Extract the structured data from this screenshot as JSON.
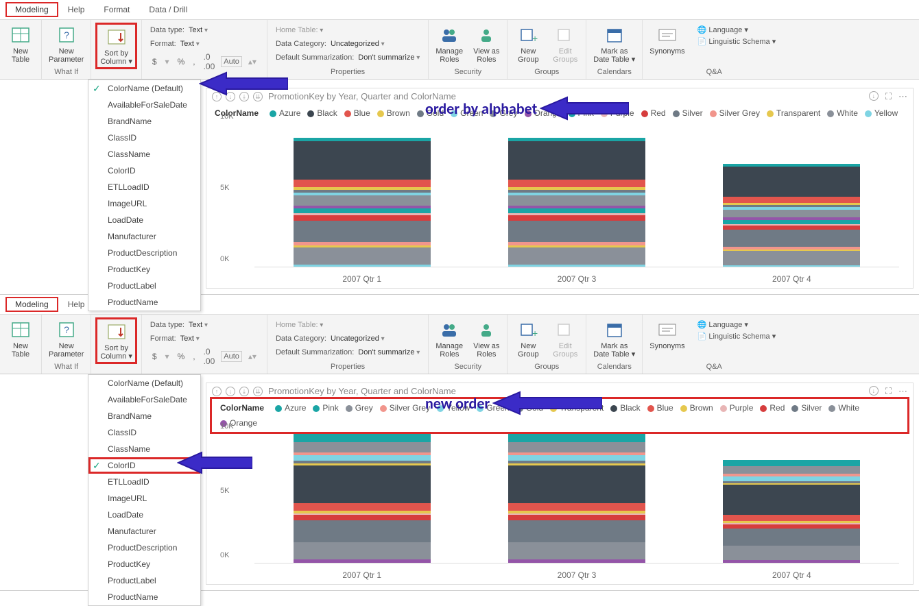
{
  "tabs": {
    "modeling": "Modeling",
    "help": "Help",
    "format": "Format",
    "datadrill": "Data / Drill"
  },
  "ribbon": {
    "new_table": "New\nTable",
    "new_parameter": "New\nParameter",
    "what_if": "What If",
    "sort_by_column": "Sort by\nColumn ▾",
    "formatting": {
      "datatype_label": "Data type:",
      "datatype_value": "Text",
      "format_label": "Format:",
      "format_value": "Text",
      "currency": "$",
      "percent": "%",
      "comma": ",",
      "decimal": ".0",
      "auto": "Auto"
    },
    "properties": {
      "home_table": "Home Table:",
      "data_category_label": "Data Category:",
      "data_category_value": "Uncategorized",
      "summ_label": "Default Summarization:",
      "summ_value": "Don't summarize",
      "group": "Properties"
    },
    "security": {
      "manage_roles": "Manage\nRoles",
      "view_as_roles": "View as\nRoles",
      "group": "Security"
    },
    "groups": {
      "new_group": "New\nGroup",
      "edit_groups": "Edit\nGroups",
      "group": "Groups"
    },
    "calendars": {
      "mark_as_date": "Mark as\nDate Table ▾",
      "group": "Calendars"
    },
    "qa": {
      "synonyms": "Synonyms",
      "language": "Language ▾",
      "linguistic": "Linguistic Schema ▾",
      "group": "Q&A"
    }
  },
  "dropdown_a": [
    "ColorName (Default)",
    "AvailableForSaleDate",
    "BrandName",
    "ClassID",
    "ClassName",
    "ColorID",
    "ETLLoadID",
    "ImageURL",
    "LoadDate",
    "Manufacturer",
    "ProductDescription",
    "ProductKey",
    "ProductLabel",
    "ProductName"
  ],
  "dropdown_b": [
    "ColorName (Default)",
    "AvailableForSaleDate",
    "BrandName",
    "ClassID",
    "ClassName",
    "ColorID",
    "ETLLoadID",
    "ImageURL",
    "LoadDate",
    "Manufacturer",
    "ProductDescription",
    "ProductKey",
    "ProductLabel",
    "ProductName"
  ],
  "annot": {
    "top": "order by alphabet",
    "bottom": "new order"
  },
  "chart": {
    "title": "PromotionKey by Year, Quarter and ColorName",
    "legend_label": "ColorName",
    "xcats": [
      "2007 Qtr 1",
      "2007 Qtr 3",
      "2007 Qtr 4"
    ],
    "yticks": [
      "0K",
      "5K",
      "10K"
    ]
  },
  "legend_a": [
    "Azure",
    "Black",
    "Blue",
    "Brown",
    "Gold",
    "Green",
    "Grey",
    "Orange",
    "Pink",
    "Purple",
    "Red",
    "Silver",
    "Silver Grey",
    "Transparent",
    "White",
    "Yellow"
  ],
  "legend_b": [
    "Azure",
    "Pink",
    "Grey",
    "Silver Grey",
    "Yellow",
    "Green",
    "Gold",
    "Transparent",
    "Black",
    "Blue",
    "Brown",
    "Purple",
    "Red",
    "Silver",
    "White",
    "Orange"
  ],
  "colors": {
    "Azure": "#1aa5a5",
    "Black": "#3c4650",
    "Blue": "#e2554d",
    "Brown": "#e6c84e",
    "Gold": "#6f7a85",
    "Green": "#7fd4e3",
    "Grey": "#8a9099",
    "Orange": "#9455a8",
    "Pink": "#1aa5a5",
    "Purple": "#e8b5b5",
    "Red": "#d63d3d",
    "Silver": "#6f7a85",
    "Silver Grey": "#f1958c",
    "Transparent": "#e6c84e",
    "White": "#8a9099",
    "Yellow": "#7fd4e3"
  },
  "chart_data": [
    {
      "type": "bar",
      "stacked": true,
      "title": "PromotionKey by Year, Quarter and ColorName",
      "categories": [
        "2007 Qtr 1",
        "2007 Qtr 3",
        "2007 Qtr 4"
      ],
      "ylabel": "",
      "ylim": [
        0,
        12000
      ],
      "series_order": [
        "Azure",
        "Black",
        "Blue",
        "Brown",
        "Gold",
        "Green",
        "Grey",
        "Orange",
        "Pink",
        "Purple",
        "Red",
        "Silver",
        "Silver Grey",
        "Transparent",
        "White",
        "Yellow"
      ],
      "series": [
        {
          "name": "Black",
          "values": [
            3500,
            3500,
            2800
          ]
        },
        {
          "name": "Silver",
          "values": [
            2000,
            2000,
            1600
          ]
        },
        {
          "name": "White",
          "values": [
            1600,
            1600,
            1300
          ]
        },
        {
          "name": "Grey",
          "values": [
            900,
            900,
            700
          ]
        },
        {
          "name": "Blue",
          "values": [
            700,
            700,
            550
          ]
        },
        {
          "name": "Red",
          "values": [
            500,
            500,
            400
          ]
        },
        {
          "name": "Silver Grey",
          "values": [
            300,
            300,
            250
          ]
        },
        {
          "name": "Pink",
          "values": [
            450,
            450,
            350
          ]
        },
        {
          "name": "Brown",
          "values": [
            250,
            250,
            200
          ]
        },
        {
          "name": "Gold",
          "values": [
            250,
            250,
            200
          ]
        },
        {
          "name": "Green",
          "values": [
            300,
            300,
            250
          ]
        },
        {
          "name": "Orange",
          "values": [
            300,
            300,
            250
          ]
        },
        {
          "name": "Azure",
          "values": [
            300,
            300,
            250
          ]
        },
        {
          "name": "Yellow",
          "values": [
            200,
            200,
            150
          ]
        },
        {
          "name": "Purple",
          "values": [
            150,
            150,
            120
          ]
        },
        {
          "name": "Transparent",
          "values": [
            150,
            150,
            120
          ]
        }
      ]
    },
    {
      "type": "bar",
      "stacked": true,
      "title": "PromotionKey by Year, Quarter and ColorName",
      "categories": [
        "2007 Qtr 1",
        "2007 Qtr 3",
        "2007 Qtr 4"
      ],
      "ylabel": "",
      "ylim": [
        0,
        12000
      ],
      "series_order": [
        "Azure",
        "Pink",
        "Grey",
        "Silver Grey",
        "Yellow",
        "Green",
        "Gold",
        "Transparent",
        "Black",
        "Blue",
        "Brown",
        "Purple",
        "Red",
        "Silver",
        "White",
        "Orange"
      ],
      "series": [
        {
          "name": "Azure",
          "values": [
            300,
            300,
            250
          ]
        },
        {
          "name": "Pink",
          "values": [
            450,
            450,
            350
          ]
        },
        {
          "name": "Grey",
          "values": [
            900,
            900,
            700
          ]
        },
        {
          "name": "Silver Grey",
          "values": [
            300,
            300,
            250
          ]
        },
        {
          "name": "Yellow",
          "values": [
            200,
            200,
            150
          ]
        },
        {
          "name": "Green",
          "values": [
            300,
            300,
            250
          ]
        },
        {
          "name": "Gold",
          "values": [
            250,
            250,
            200
          ]
        },
        {
          "name": "Transparent",
          "values": [
            150,
            150,
            120
          ]
        },
        {
          "name": "Black",
          "values": [
            3500,
            3500,
            2800
          ]
        },
        {
          "name": "Blue",
          "values": [
            700,
            700,
            550
          ]
        },
        {
          "name": "Brown",
          "values": [
            250,
            250,
            200
          ]
        },
        {
          "name": "Purple",
          "values": [
            150,
            150,
            120
          ]
        },
        {
          "name": "Red",
          "values": [
            500,
            500,
            400
          ]
        },
        {
          "name": "Silver",
          "values": [
            2000,
            2000,
            1600
          ]
        },
        {
          "name": "White",
          "values": [
            1600,
            1600,
            1300
          ]
        },
        {
          "name": "Orange",
          "values": [
            300,
            300,
            250
          ]
        }
      ]
    }
  ]
}
